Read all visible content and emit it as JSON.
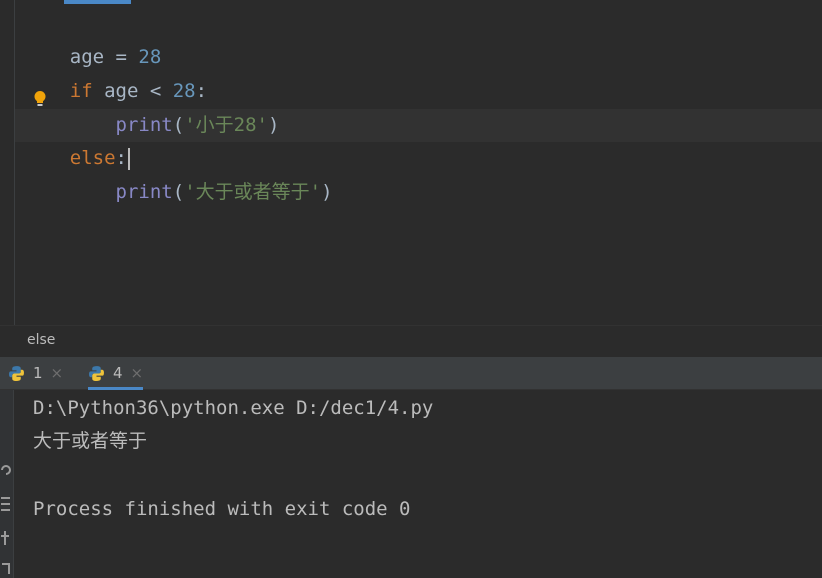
{
  "editor": {
    "lines": [
      {
        "parts": [
          {
            "t": "age = ",
            "c": "plain"
          },
          {
            "t": "28",
            "c": "num"
          }
        ]
      },
      {
        "parts": [
          {
            "t": "if",
            "c": "kw"
          },
          {
            "t": " age < ",
            "c": "plain"
          },
          {
            "t": "28",
            "c": "num"
          },
          {
            "t": ":",
            "c": "plain"
          }
        ]
      },
      {
        "parts": [
          {
            "t": "    ",
            "c": "plain"
          },
          {
            "t": "print",
            "c": "fn"
          },
          {
            "t": "(",
            "c": "plain"
          },
          {
            "t": "'小于28'",
            "c": "str"
          },
          {
            "t": ")",
            "c": "plain"
          }
        ]
      },
      {
        "parts": [
          {
            "t": "else",
            "c": "kw"
          },
          {
            "t": ":",
            "c": "plain"
          }
        ]
      },
      {
        "parts": [
          {
            "t": "    ",
            "c": "plain"
          },
          {
            "t": "print",
            "c": "fn"
          },
          {
            "t": "(",
            "c": "plain"
          },
          {
            "t": "'大于或者等于'",
            "c": "str"
          },
          {
            "t": ")",
            "c": "plain"
          }
        ]
      }
    ]
  },
  "breadcrumb": {
    "text": "else"
  },
  "run_tabs": [
    {
      "label": "1",
      "close": "×"
    },
    {
      "label": "4",
      "close": "×"
    }
  ],
  "console": {
    "lines": [
      "D:\\Python36\\python.exe D:/dec1/4.py",
      "大于或者等于",
      "",
      "Process finished with exit code 0"
    ]
  },
  "colors": {
    "background": "#2b2b2b",
    "keyword": "#cc7832",
    "number": "#6897bb",
    "builtin": "#8888c6",
    "string": "#6a8759",
    "accent": "#4a88c7"
  }
}
